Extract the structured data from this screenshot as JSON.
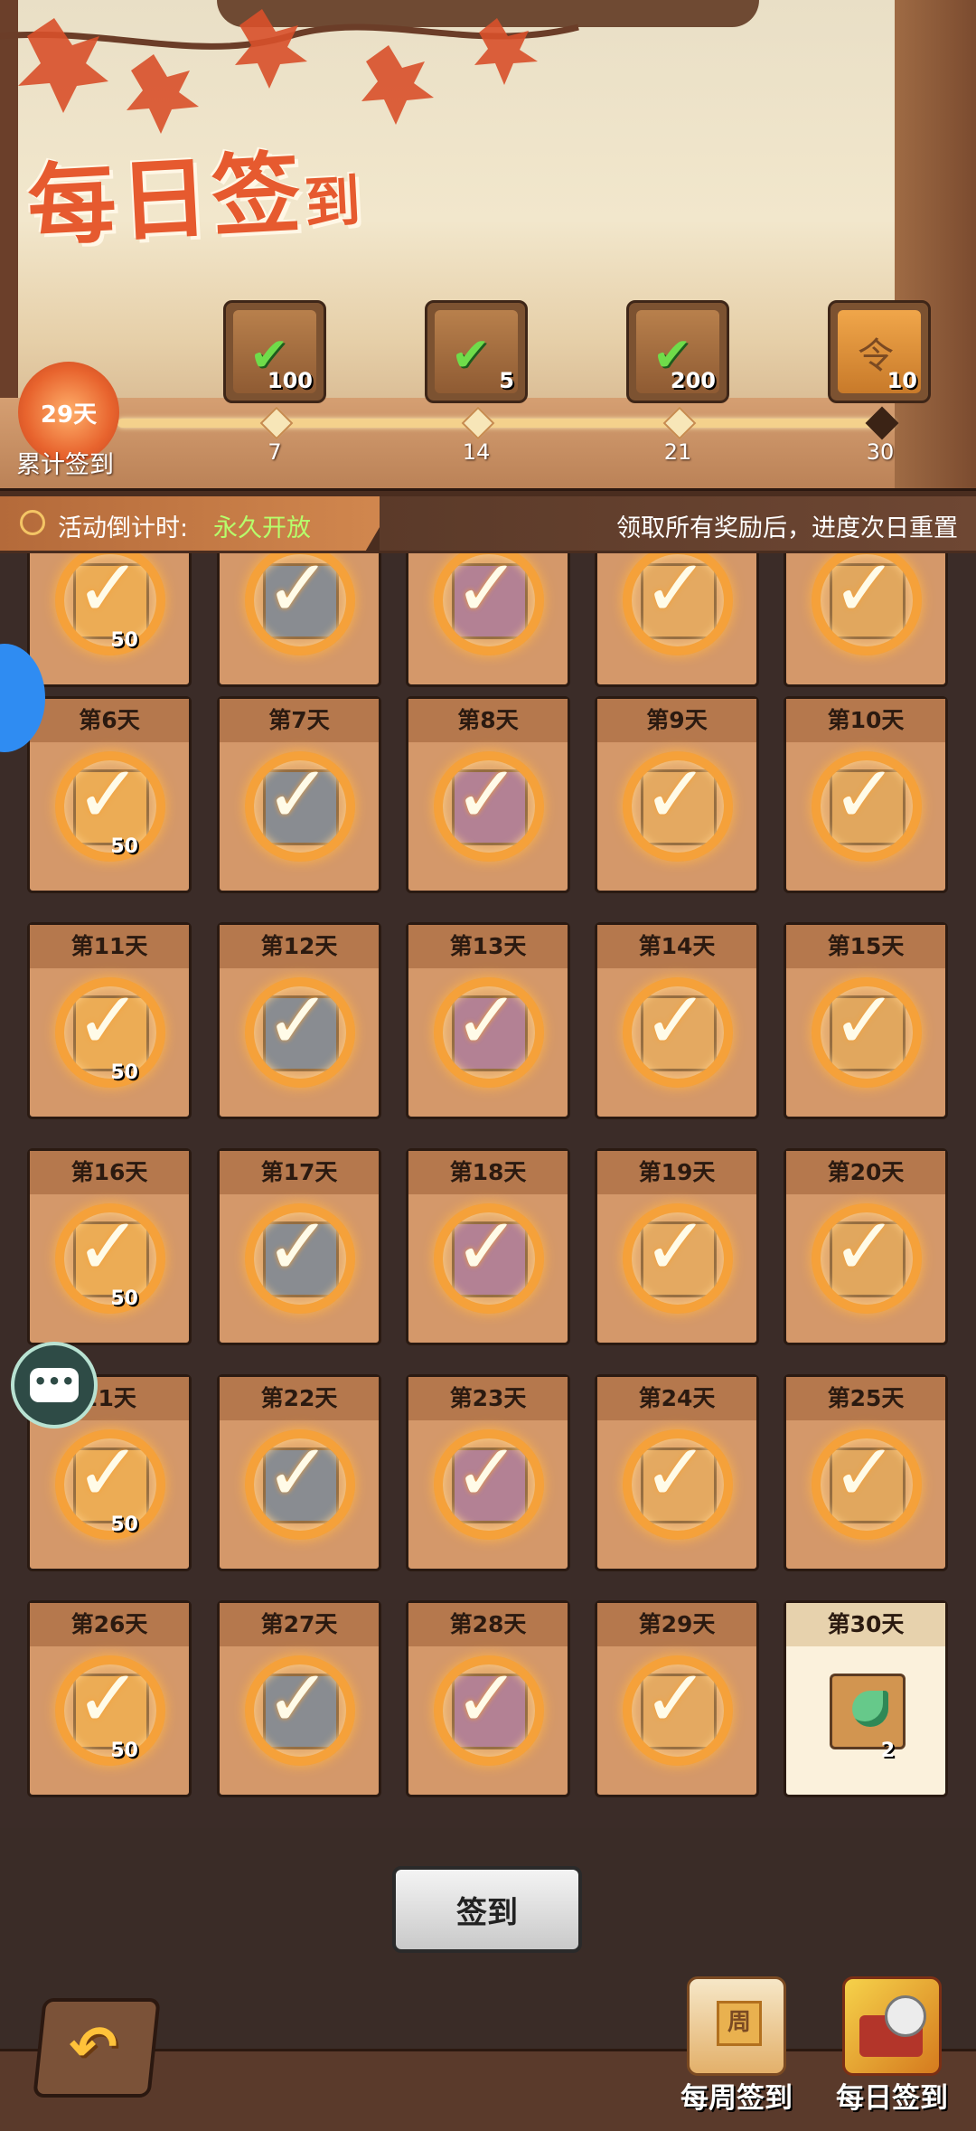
{
  "header": {
    "title_main": "每日签",
    "title_small": "到",
    "tally_value": "29天",
    "tally_label": "累计签到",
    "milestones": [
      {
        "qty": "100",
        "day": "7",
        "icon": "check-reward-icon"
      },
      {
        "qty": "5",
        "day": "14",
        "icon": "check-reward-icon"
      },
      {
        "qty": "200",
        "day": "21",
        "icon": "check-reward-icon"
      },
      {
        "qty": "10",
        "day": "30",
        "icon": "token-scroll-icon"
      }
    ]
  },
  "infobar": {
    "countdown_label": "活动倒计时:",
    "countdown_value": "永久开放",
    "note": "领取所有奖励后，进度次日重置"
  },
  "days": [
    {
      "label": "",
      "qty": "50",
      "color": "gold"
    },
    {
      "label": "",
      "qty": "",
      "color": "blue"
    },
    {
      "label": "",
      "qty": "",
      "color": "purple"
    },
    {
      "label": "",
      "qty": "",
      "color": "map"
    },
    {
      "label": "",
      "qty": "",
      "color": "leaf"
    },
    {
      "label": "第6天",
      "qty": "50",
      "color": "gold"
    },
    {
      "label": "第7天",
      "qty": "",
      "color": "blue"
    },
    {
      "label": "第8天",
      "qty": "",
      "color": "purple"
    },
    {
      "label": "第9天",
      "qty": "",
      "color": "map"
    },
    {
      "label": "第10天",
      "qty": "",
      "color": "leaf"
    },
    {
      "label": "第11天",
      "qty": "50",
      "color": "gold"
    },
    {
      "label": "第12天",
      "qty": "",
      "color": "blue"
    },
    {
      "label": "第13天",
      "qty": "",
      "color": "purple"
    },
    {
      "label": "第14天",
      "qty": "",
      "color": "map"
    },
    {
      "label": "第15天",
      "qty": "",
      "color": "leaf"
    },
    {
      "label": "第16天",
      "qty": "50",
      "color": "gold"
    },
    {
      "label": "第17天",
      "qty": "",
      "color": "blue"
    },
    {
      "label": "第18天",
      "qty": "",
      "color": "purple"
    },
    {
      "label": "第19天",
      "qty": "",
      "color": "map"
    },
    {
      "label": "第20天",
      "qty": "",
      "color": "leaf"
    },
    {
      "label": "21天",
      "qty": "50",
      "color": "gold"
    },
    {
      "label": "第22天",
      "qty": "",
      "color": "blue"
    },
    {
      "label": "第23天",
      "qty": "",
      "color": "purple"
    },
    {
      "label": "第24天",
      "qty": "",
      "color": "map"
    },
    {
      "label": "第25天",
      "qty": "",
      "color": "leaf"
    },
    {
      "label": "第26天",
      "qty": "50",
      "color": "gold"
    },
    {
      "label": "第27天",
      "qty": "",
      "color": "blue"
    },
    {
      "label": "第28天",
      "qty": "",
      "color": "purple"
    },
    {
      "label": "第29天",
      "qty": "",
      "color": "map"
    },
    {
      "label": "第30天",
      "qty": "2",
      "color": "leaf",
      "today": true
    }
  ],
  "actions": {
    "signin_label": "签到",
    "back_icon": "back-arrow-icon",
    "nav_weekly": "每周签到",
    "nav_daily": "每日签到"
  },
  "colors": {
    "accent_orange": "#f5a13a",
    "title_red": "#e65a2f",
    "countdown_green": "#b6ff6c",
    "edge_blue": "#2f8cf2"
  }
}
